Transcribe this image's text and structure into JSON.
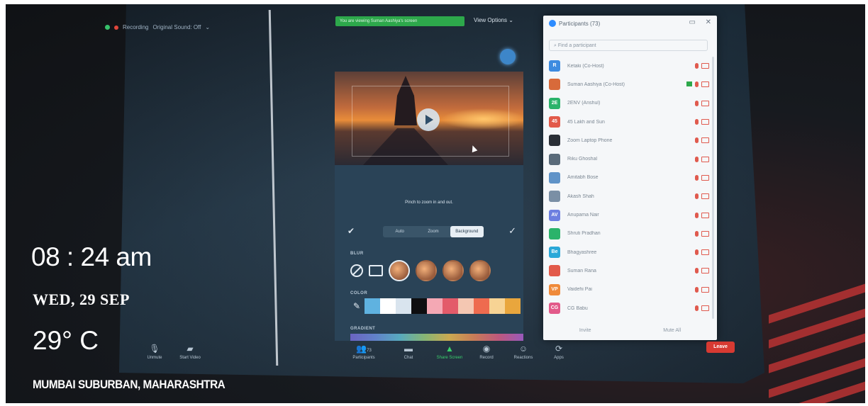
{
  "meeting": {
    "recording_label": "Recording",
    "original_sound_label": "Original Sound: Off",
    "share_banner": "You are viewing Suman Aashiya's screen",
    "view_options": "View Options"
  },
  "virtual_background": {
    "pinch_hint": "Pinch to zoom in and out.",
    "modes": [
      "Auto",
      "Zoom",
      "Background"
    ],
    "selected_mode": "Background",
    "blur_label": "BLUR",
    "color_label": "COLOR",
    "gradient_label": "GRADIENT",
    "colors": [
      "#5fb2e0",
      "#ffffff",
      "#d9e4ee",
      "#0e0e10",
      "#f4a8b4",
      "#e35b6a",
      "#f4c7b2",
      "#ee6b4f",
      "#f7d394",
      "#e9a63d"
    ]
  },
  "participants": {
    "title": "Participants (73)",
    "search_placeholder": "Find a participant",
    "rows": [
      {
        "initials": "R",
        "name": "Ketaki (Co-Host)",
        "color": "#3d8be0"
      },
      {
        "initials": "",
        "name": "Suman Aashiya (Co-Host)",
        "color": "#d86a3a"
      },
      {
        "initials": "2E",
        "name": "2ENV (Anshul)",
        "color": "#2bb36a"
      },
      {
        "initials": "45",
        "name": "45 Lakh and Sun",
        "color": "#e25a4a"
      },
      {
        "initials": "",
        "name": "Zoom Laptop Phone",
        "color": "#2a2f36"
      },
      {
        "initials": "",
        "name": "Riku Ghoshal",
        "color": "#5a6b7a"
      },
      {
        "initials": "",
        "name": "Amitabh Bose",
        "color": "#5f93c8"
      },
      {
        "initials": "",
        "name": "Akash Shah",
        "color": "#7a8fa5"
      },
      {
        "initials": "AV",
        "name": "Anupama Nair",
        "color": "#6d7fe0"
      },
      {
        "initials": "",
        "name": "Shruti Pradhan",
        "color": "#2bb36a"
      },
      {
        "initials": "Be",
        "name": "Bhagyashree",
        "color": "#2aa8d8"
      },
      {
        "initials": "",
        "name": "Suman Rana",
        "color": "#e25a4a"
      },
      {
        "initials": "VP",
        "name": "Vaidehi Pai",
        "color": "#ef8a3a"
      },
      {
        "initials": "CG",
        "name": "CG Babu",
        "color": "#e25a8a"
      }
    ],
    "footer": [
      "Invite",
      "Mute All"
    ]
  },
  "toolbar": {
    "items": [
      {
        "name": "unmute",
        "label": "Unmute",
        "icon": "mic-icon"
      },
      {
        "name": "start-video",
        "label": "Start Video",
        "icon": "camera-icon"
      },
      {
        "name": "participants",
        "label": "Participants",
        "icon": "people-icon",
        "count": "73"
      },
      {
        "name": "chat",
        "label": "Chat",
        "icon": "chat-icon"
      },
      {
        "name": "share-screen",
        "label": "Share Screen",
        "icon": "share-icon"
      },
      {
        "name": "record",
        "label": "Record",
        "icon": "record-icon"
      },
      {
        "name": "reactions",
        "label": "Reactions",
        "icon": "reaction-icon"
      },
      {
        "name": "apps",
        "label": "Apps",
        "icon": "apps-icon"
      }
    ],
    "leave_label": "Leave"
  },
  "overlay": {
    "time": "08 : 24 am",
    "date": "WED, 29 SEP",
    "temperature": "29° C",
    "location": "MUMBAI SUBURBAN, MAHARASHTRA"
  }
}
